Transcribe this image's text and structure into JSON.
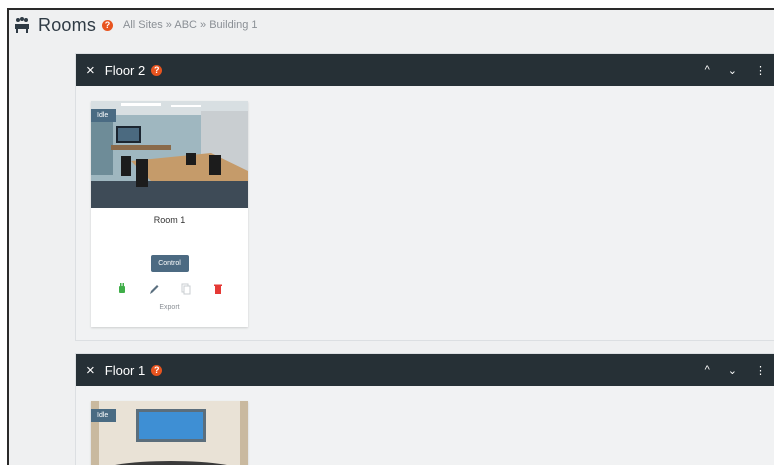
{
  "header": {
    "title": "Rooms",
    "help": "?",
    "breadcrumb": "All Sites » ABC » Building 1"
  },
  "floors": [
    {
      "name": "Floor 2",
      "close": "×",
      "help": "?",
      "controls": [
        "^",
        "⌄",
        "⋮"
      ],
      "rooms": [
        {
          "status": "Idle",
          "name": "Room 1",
          "control_label": "Control",
          "export_label": "Export",
          "action_icons": [
            "green-plug-icon",
            "pencil-icon",
            "copy-icon",
            "trash-icon"
          ]
        }
      ]
    },
    {
      "name": "Floor 1",
      "close": "×",
      "help": "?",
      "controls": [
        "^",
        "⌄",
        "⋮"
      ],
      "rooms": [
        {
          "status": "Idle"
        }
      ]
    }
  ],
  "colors": {
    "accent_dark": "#263036",
    "help_orange": "#e8541f",
    "idle_badge": "#4a6b83",
    "plug_green": "#3fae49",
    "trash_red": "#e53935"
  }
}
